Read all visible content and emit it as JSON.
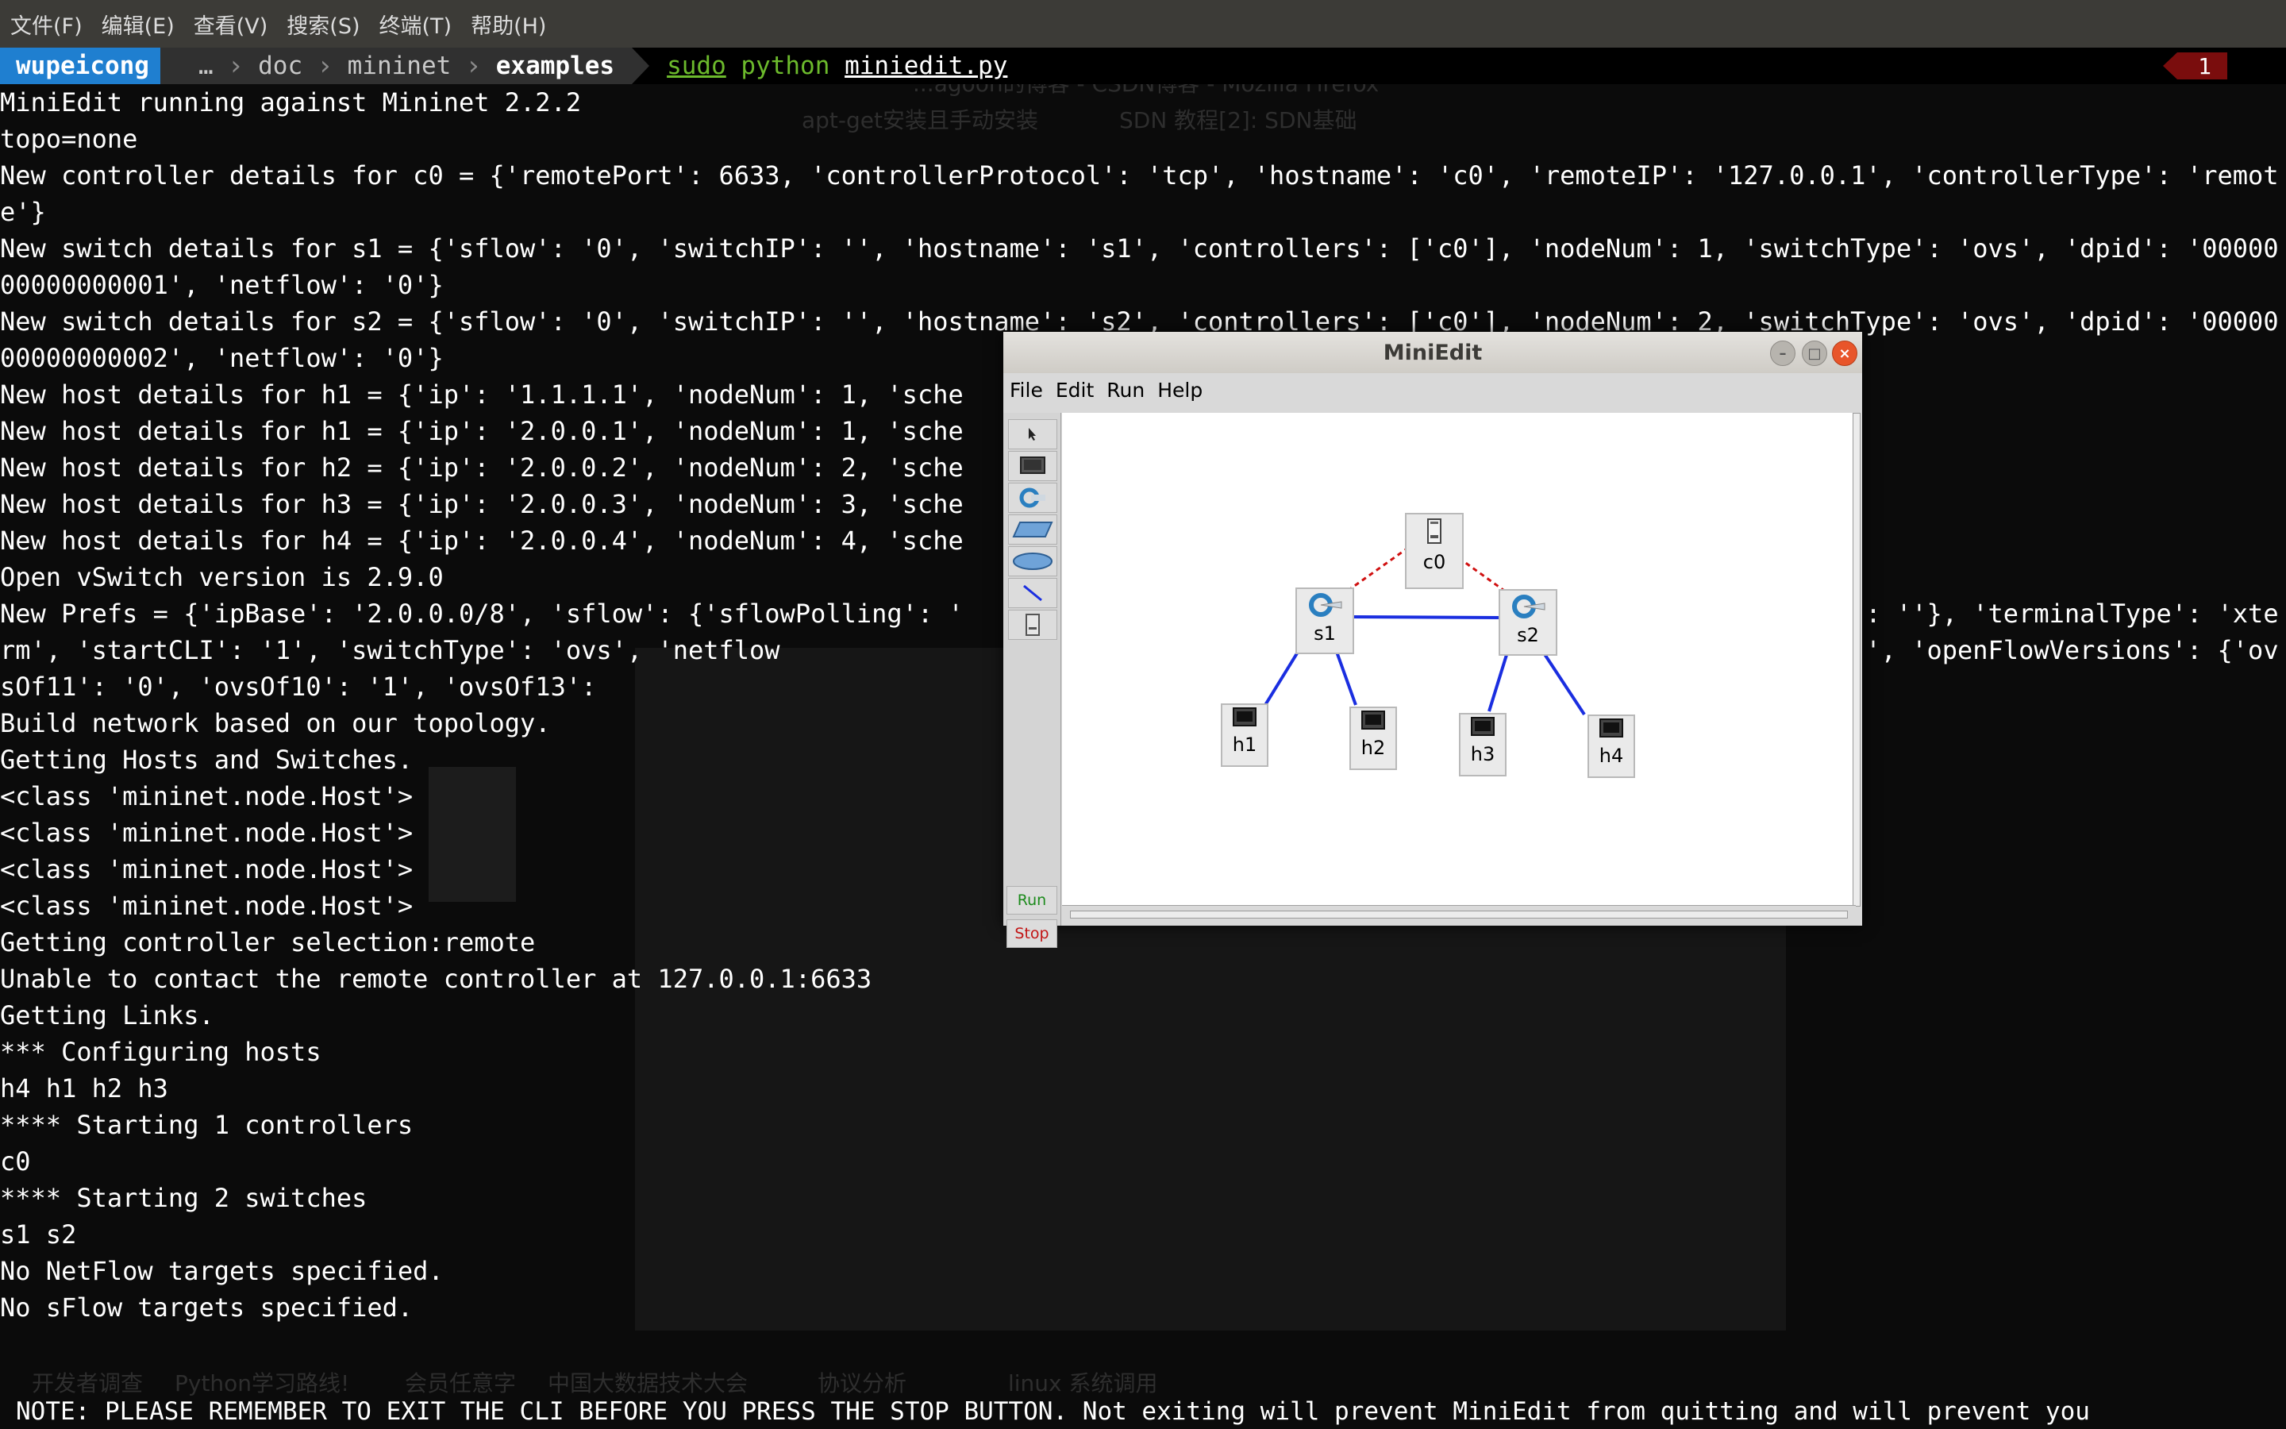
{
  "terminal_menu": [
    "文件(F)",
    "编辑(E)",
    "查看(V)",
    "搜索(S)",
    "终端(T)",
    "帮助(H)"
  ],
  "prompt": {
    "user": "wupeicong",
    "path": [
      "…",
      "doc",
      "mininet",
      "examples"
    ],
    "command": {
      "sudo": "sudo",
      "python": "python",
      "script": "miniedit.py"
    },
    "error_count": "1"
  },
  "background_window": {
    "title": "...agoon的博客 - CSDN博客 - Mozilla Firefox",
    "tabs": [
      "apt-get安装且手动安装",
      "SDN 教程[2]: SDN基础"
    ],
    "footer_links": [
      "开发者调查",
      "Python学习路线!",
      "会员任意字",
      "中国大数据技术大会",
      "协议分析",
      "linux 系统调用"
    ]
  },
  "terminal_output": [
    "MiniEdit running against Mininet 2.2.2",
    "topo=none",
    "New controller details for c0 = {'remotePort': 6633, 'controllerProtocol': 'tcp', 'hostname': 'c0', 'remoteIP': '127.0.0.1', 'controllerType': 'remote'}",
    "New switch details for s1 = {'sflow': '0', 'switchIP': '', 'hostname': 's1', 'controllers': ['c0'], 'nodeNum': 1, 'switchType': 'ovs', 'dpid': '0000000000000001', 'netflow': '0'}",
    "New switch details for s2 = {'sflow': '0', 'switchIP': '', 'hostname': 's2', 'controllers': ['c0'], 'nodeNum': 2, 'switchType': 'ovs', 'dpid': '0000000000000002', 'netflow': '0'}",
    "New host details for h1 = {'ip': '1.1.1.1', 'nodeNum': 1, 'sche",
    "New host details for h1 = {'ip': '2.0.0.1', 'nodeNum': 1, 'sche",
    "New host details for h2 = {'ip': '2.0.0.2', 'nodeNum': 2, 'sche",
    "New host details for h3 = {'ip': '2.0.0.3', 'nodeNum': 3, 'sche",
    "New host details for h4 = {'ip': '2.0.0.4', 'nodeNum': 4, 'sche",
    "Open vSwitch version is 2.9.0",
    "New Prefs = {'ipBase': '2.0.0.0/8', 'sflow': {'sflowPolling': '                                                 lowTarget': ''}, 'terminalType': 'xterm', 'startCLI': '1', 'switchType': 'ovs', 'netflow                                                 t': '600'}, 'dpctl': '', 'openFlowVersions': {'ovsOf11': '0', 'ovsOf10': '1', 'ovsOf13':",
    "Build network based on our topology.",
    "Getting Hosts and Switches.",
    "<class 'mininet.node.Host'>",
    "<class 'mininet.node.Host'>",
    "<class 'mininet.node.Host'>",
    "<class 'mininet.node.Host'>",
    "Getting controller selection:remote",
    "Unable to contact the remote controller at 127.0.0.1:6633",
    "Getting Links.",
    "*** Configuring hosts",
    "h4 h1 h2 h3",
    "**** Starting 1 controllers",
    "c0",
    "**** Starting 2 switches",
    "s1 s2",
    "No NetFlow targets specified.",
    "No sFlow targets specified."
  ],
  "bottom_note": "NOTE: PLEASE REMEMBER TO EXIT THE CLI BEFORE YOU PRESS THE STOP BUTTON. Not exiting will prevent MiniEdit from quitting and will prevent you",
  "miniedit": {
    "title": "MiniEdit",
    "menu": [
      "File",
      "Edit",
      "Run",
      "Help"
    ],
    "tools": [
      "select-tool",
      "host-tool",
      "switch-tool",
      "legacy-switch-tool",
      "legacy-router-tool",
      "netlink-tool",
      "controller-tool"
    ],
    "run_label": "Run",
    "stop_label": "Stop",
    "nodes": {
      "c0": "c0",
      "s1": "s1",
      "s2": "s2",
      "h1": "h1",
      "h2": "h2",
      "h3": "h3",
      "h4": "h4"
    },
    "colors": {
      "link": "#1a2ee0",
      "control_link": "#d01010"
    }
  }
}
